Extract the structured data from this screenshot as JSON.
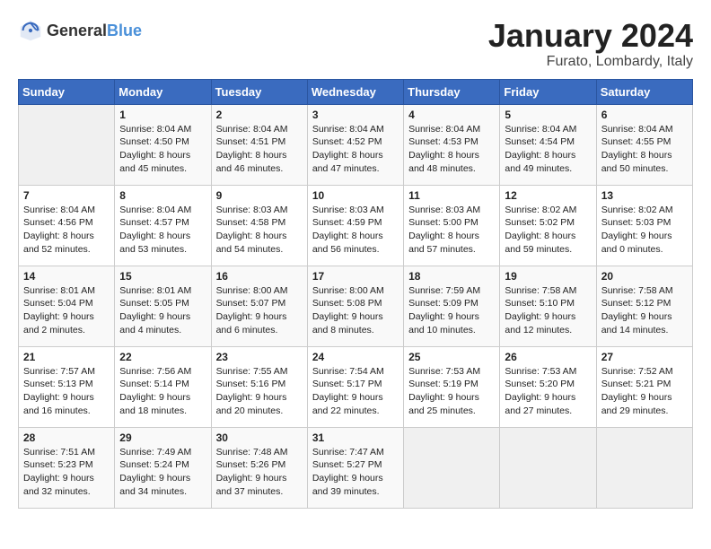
{
  "header": {
    "logo_general": "General",
    "logo_blue": "Blue",
    "month": "January 2024",
    "location": "Furato, Lombardy, Italy"
  },
  "weekdays": [
    "Sunday",
    "Monday",
    "Tuesday",
    "Wednesday",
    "Thursday",
    "Friday",
    "Saturday"
  ],
  "weeks": [
    [
      {
        "day": "",
        "info": ""
      },
      {
        "day": "1",
        "info": "Sunrise: 8:04 AM\nSunset: 4:50 PM\nDaylight: 8 hours\nand 45 minutes."
      },
      {
        "day": "2",
        "info": "Sunrise: 8:04 AM\nSunset: 4:51 PM\nDaylight: 8 hours\nand 46 minutes."
      },
      {
        "day": "3",
        "info": "Sunrise: 8:04 AM\nSunset: 4:52 PM\nDaylight: 8 hours\nand 47 minutes."
      },
      {
        "day": "4",
        "info": "Sunrise: 8:04 AM\nSunset: 4:53 PM\nDaylight: 8 hours\nand 48 minutes."
      },
      {
        "day": "5",
        "info": "Sunrise: 8:04 AM\nSunset: 4:54 PM\nDaylight: 8 hours\nand 49 minutes."
      },
      {
        "day": "6",
        "info": "Sunrise: 8:04 AM\nSunset: 4:55 PM\nDaylight: 8 hours\nand 50 minutes."
      }
    ],
    [
      {
        "day": "7",
        "info": "Sunrise: 8:04 AM\nSunset: 4:56 PM\nDaylight: 8 hours\nand 52 minutes."
      },
      {
        "day": "8",
        "info": "Sunrise: 8:04 AM\nSunset: 4:57 PM\nDaylight: 8 hours\nand 53 minutes."
      },
      {
        "day": "9",
        "info": "Sunrise: 8:03 AM\nSunset: 4:58 PM\nDaylight: 8 hours\nand 54 minutes."
      },
      {
        "day": "10",
        "info": "Sunrise: 8:03 AM\nSunset: 4:59 PM\nDaylight: 8 hours\nand 56 minutes."
      },
      {
        "day": "11",
        "info": "Sunrise: 8:03 AM\nSunset: 5:00 PM\nDaylight: 8 hours\nand 57 minutes."
      },
      {
        "day": "12",
        "info": "Sunrise: 8:02 AM\nSunset: 5:02 PM\nDaylight: 8 hours\nand 59 minutes."
      },
      {
        "day": "13",
        "info": "Sunrise: 8:02 AM\nSunset: 5:03 PM\nDaylight: 9 hours\nand 0 minutes."
      }
    ],
    [
      {
        "day": "14",
        "info": "Sunrise: 8:01 AM\nSunset: 5:04 PM\nDaylight: 9 hours\nand 2 minutes."
      },
      {
        "day": "15",
        "info": "Sunrise: 8:01 AM\nSunset: 5:05 PM\nDaylight: 9 hours\nand 4 minutes."
      },
      {
        "day": "16",
        "info": "Sunrise: 8:00 AM\nSunset: 5:07 PM\nDaylight: 9 hours\nand 6 minutes."
      },
      {
        "day": "17",
        "info": "Sunrise: 8:00 AM\nSunset: 5:08 PM\nDaylight: 9 hours\nand 8 minutes."
      },
      {
        "day": "18",
        "info": "Sunrise: 7:59 AM\nSunset: 5:09 PM\nDaylight: 9 hours\nand 10 minutes."
      },
      {
        "day": "19",
        "info": "Sunrise: 7:58 AM\nSunset: 5:10 PM\nDaylight: 9 hours\nand 12 minutes."
      },
      {
        "day": "20",
        "info": "Sunrise: 7:58 AM\nSunset: 5:12 PM\nDaylight: 9 hours\nand 14 minutes."
      }
    ],
    [
      {
        "day": "21",
        "info": "Sunrise: 7:57 AM\nSunset: 5:13 PM\nDaylight: 9 hours\nand 16 minutes."
      },
      {
        "day": "22",
        "info": "Sunrise: 7:56 AM\nSunset: 5:14 PM\nDaylight: 9 hours\nand 18 minutes."
      },
      {
        "day": "23",
        "info": "Sunrise: 7:55 AM\nSunset: 5:16 PM\nDaylight: 9 hours\nand 20 minutes."
      },
      {
        "day": "24",
        "info": "Sunrise: 7:54 AM\nSunset: 5:17 PM\nDaylight: 9 hours\nand 22 minutes."
      },
      {
        "day": "25",
        "info": "Sunrise: 7:53 AM\nSunset: 5:19 PM\nDaylight: 9 hours\nand 25 minutes."
      },
      {
        "day": "26",
        "info": "Sunrise: 7:53 AM\nSunset: 5:20 PM\nDaylight: 9 hours\nand 27 minutes."
      },
      {
        "day": "27",
        "info": "Sunrise: 7:52 AM\nSunset: 5:21 PM\nDaylight: 9 hours\nand 29 minutes."
      }
    ],
    [
      {
        "day": "28",
        "info": "Sunrise: 7:51 AM\nSunset: 5:23 PM\nDaylight: 9 hours\nand 32 minutes."
      },
      {
        "day": "29",
        "info": "Sunrise: 7:49 AM\nSunset: 5:24 PM\nDaylight: 9 hours\nand 34 minutes."
      },
      {
        "day": "30",
        "info": "Sunrise: 7:48 AM\nSunset: 5:26 PM\nDaylight: 9 hours\nand 37 minutes."
      },
      {
        "day": "31",
        "info": "Sunrise: 7:47 AM\nSunset: 5:27 PM\nDaylight: 9 hours\nand 39 minutes."
      },
      {
        "day": "",
        "info": ""
      },
      {
        "day": "",
        "info": ""
      },
      {
        "day": "",
        "info": ""
      }
    ]
  ]
}
